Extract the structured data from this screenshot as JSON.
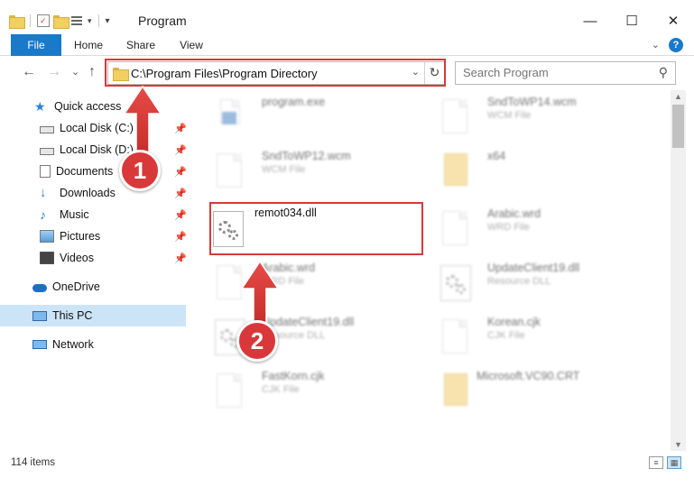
{
  "window": {
    "title": "Program",
    "minimize": "—",
    "maximize": "☐",
    "close": "✕"
  },
  "ribbon": {
    "tabs": [
      {
        "label": "File"
      },
      {
        "label": "Home"
      },
      {
        "label": "Share"
      },
      {
        "label": "View"
      }
    ],
    "expand": "⌄",
    "help": "?"
  },
  "nav": {
    "back": "←",
    "forward": "→",
    "recent": "⌄",
    "up": "↑"
  },
  "address": {
    "path": "C:\\Program Files\\Program Directory",
    "dropdown": "⌄",
    "refresh": "↻"
  },
  "search": {
    "placeholder": "Search Program",
    "icon": "search-icon"
  },
  "sidebar": {
    "items": [
      {
        "label": "Quick access",
        "icon": "star-icon"
      },
      {
        "label": "Local Disk (C:)",
        "icon": "drive-icon",
        "pinned": true
      },
      {
        "label": "Local Disk (D:)",
        "icon": "drive-icon",
        "pinned": true
      },
      {
        "label": "Documents",
        "icon": "documents-icon",
        "pinned": true
      },
      {
        "label": "Downloads",
        "icon": "download-icon",
        "pinned": true
      },
      {
        "label": "Music",
        "icon": "music-icon",
        "pinned": true
      },
      {
        "label": "Pictures",
        "icon": "pictures-icon",
        "pinned": true
      },
      {
        "label": "Videos",
        "icon": "videos-icon",
        "pinned": true
      },
      {
        "label": "OneDrive",
        "icon": "cloud-icon"
      },
      {
        "label": "This PC",
        "icon": "computer-icon",
        "selected": true
      },
      {
        "label": "Network",
        "icon": "network-icon"
      }
    ],
    "pin_glyph": "📌"
  },
  "files": [
    {
      "name": "program.exe",
      "type": "",
      "col": 0,
      "row": 0,
      "icon": "exe-icon"
    },
    {
      "name": "SndToWP14.wcm",
      "type": "WCM File",
      "col": 1,
      "row": 0,
      "icon": "file-icon"
    },
    {
      "name": "SndToWP12.wcm",
      "type": "WCM File",
      "col": 0,
      "row": 1,
      "icon": "file-icon"
    },
    {
      "name": "x64",
      "type": "",
      "col": 1,
      "row": 1,
      "icon": "folder-icon"
    },
    {
      "name": "remot034.dll",
      "type": "",
      "col": 0,
      "row": 2,
      "icon": "dll-gear-icon",
      "focus": true
    },
    {
      "name": "Arabic.wrd",
      "type": "WRD File",
      "col": 1,
      "row": 2,
      "icon": "file-icon"
    },
    {
      "name": "Arabic.wrd",
      "type": "WRD File",
      "col": 0,
      "row": 3,
      "icon": "file-icon"
    },
    {
      "name": "UpdateClient19.dll",
      "type": "Resource DLL",
      "col": 1,
      "row": 3,
      "icon": "dll-gear-icon"
    },
    {
      "name": "UpdateClient19.dll",
      "type": "Resource DLL",
      "col": 0,
      "row": 4,
      "icon": "dll-gear-icon"
    },
    {
      "name": "Korean.cjk",
      "type": "CJK File",
      "col": 1,
      "row": 4,
      "icon": "file-icon"
    },
    {
      "name": "FastKorn.cjk",
      "type": "CJK File",
      "col": 0,
      "row": 5,
      "icon": "file-icon"
    },
    {
      "name": "Microsoft.VC90.CRT",
      "type": "",
      "col": 1,
      "row": 5,
      "icon": "folder-icon"
    }
  ],
  "status": {
    "count": "114 items"
  },
  "annotations": {
    "step1": "1",
    "step2": "2"
  }
}
